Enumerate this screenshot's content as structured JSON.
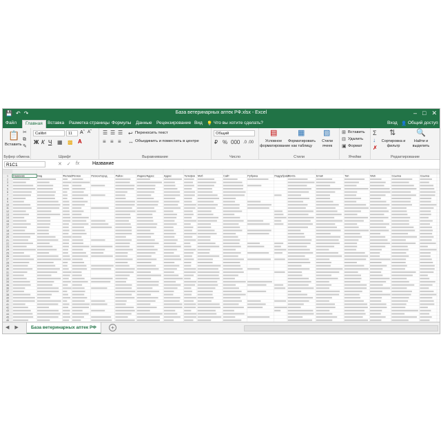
{
  "window": {
    "title": "База ветеринарных аптек РФ.xlsx - Excel",
    "login": "Вход",
    "share": "Общий доступ",
    "tell_me": "Что вы хотите сделать?"
  },
  "tabs": [
    "Файл",
    "Главная",
    "Вставка",
    "Разметка страницы",
    "Формулы",
    "Данные",
    "Рецензирование",
    "Вид"
  ],
  "active_tab": "Главная",
  "ribbon": {
    "clipboard": {
      "paste": "Вставить",
      "label": "Буфер обмена"
    },
    "font": {
      "name": "Calibri",
      "size": "11",
      "label": "Шрифт",
      "bold": "Ж",
      "italic": "К",
      "underline": "Ч"
    },
    "alignment": {
      "wrap": "Переносить текст",
      "merge": "Объединить и поместить в центре",
      "label": "Выравнивание"
    },
    "number": {
      "format": "Общий",
      "label": "Число"
    },
    "styles": {
      "conditional": "Условное форматирование",
      "as_table": "Форматировать как таблицу",
      "cell_styles": "Стили ячеек",
      "label": "Стили"
    },
    "cells": {
      "insert": "Вставить",
      "delete": "Удалить",
      "format": "Формат",
      "label": "Ячейки"
    },
    "editing": {
      "sort": "Сортировка и фильтр",
      "find": "Найти и выделить",
      "label": "Редактирование"
    }
  },
  "formula_bar": {
    "name_box": "R1C1",
    "cancel": "✕",
    "enter": "✓",
    "fx": "fx",
    "content": "Название"
  },
  "sheet": {
    "row_numbers": [
      "1",
      "2",
      "3",
      "4",
      "5",
      "6",
      "7",
      "8",
      "9",
      "10",
      "11",
      "12",
      "13",
      "14",
      "15",
      "16",
      "17",
      "18",
      "19",
      "20",
      "21",
      "22",
      "23",
      "24",
      "25",
      "26",
      "27",
      "28",
      "29",
      "30",
      "31",
      "32",
      "33",
      "34",
      "35",
      "36",
      "37",
      "38",
      "39",
      "40",
      "41",
      "42",
      "43",
      "44",
      "45",
      "46"
    ],
    "header_row": [
      "Название",
      "Вид",
      "Филиал",
      "Регион",
      "Регион/город",
      "Район",
      "Индекс/Адрес",
      "Адрес",
      "Телефон",
      "Моб",
      "Сайт",
      "Рубрика",
      "Подрубрика",
      "Почта",
      "Email",
      "Тип",
      "Web",
      "Ссылка",
      "Ссылка"
    ],
    "tab_name": "База ветеринарных аптек РФ"
  },
  "colors": {
    "brand": "#217346",
    "ribbon_bg": "#f3f3f3",
    "grid_line": "#e1e1e1",
    "header_bg": "#f0f0f0"
  },
  "icons": [
    "undo-icon",
    "redo-icon",
    "save-icon",
    "paste-icon",
    "cut-icon",
    "copy-icon",
    "format-painter-icon",
    "bold-icon",
    "italic-icon",
    "underline-icon",
    "font-color-icon",
    "fill-color-icon",
    "border-icon",
    "align-left-icon",
    "align-center-icon",
    "align-right-icon",
    "wrap-text-icon",
    "merge-icon",
    "currency-icon",
    "percent-icon",
    "comma-icon",
    "conditional-format-icon",
    "table-icon",
    "cell-styles-icon",
    "insert-cells-icon",
    "delete-cells-icon",
    "format-cells-icon",
    "autosum-icon",
    "fill-icon",
    "clear-icon",
    "sort-filter-icon",
    "find-select-icon",
    "lightbulb-icon",
    "user-icon",
    "minimize-icon",
    "restore-icon",
    "close-icon",
    "add-sheet-icon"
  ]
}
